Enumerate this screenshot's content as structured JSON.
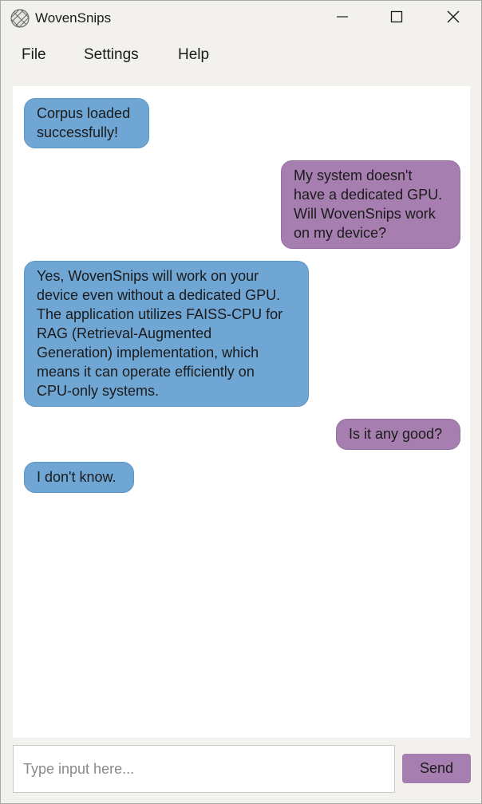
{
  "window": {
    "title": "WovenSnips",
    "logo_icon": "woven-sphere-icon",
    "controls": {
      "minimize_icon": "minimize-icon",
      "maximize_icon": "maximize-icon",
      "close_icon": "close-icon"
    }
  },
  "menu": {
    "items": [
      {
        "label": "File"
      },
      {
        "label": "Settings"
      },
      {
        "label": "Help"
      }
    ]
  },
  "chat": {
    "messages": [
      {
        "sender": "bot",
        "text": "Corpus loaded\nsuccessfully!"
      },
      {
        "sender": "user",
        "text": "My system doesn't\nhave a dedicated GPU.\nWill WovenSnips work\non my device?"
      },
      {
        "sender": "bot",
        "text": "Yes, WovenSnips will work on your\ndevice even without a dedicated GPU.\nThe application utilizes FAISS-CPU for\nRAG (Retrieval-Augmented\nGeneration) implementation, which\nmeans it can operate efficiently on\nCPU-only systems."
      },
      {
        "sender": "user",
        "text": "Is it any good?"
      },
      {
        "sender": "bot",
        "text": "I don't know."
      }
    ]
  },
  "composer": {
    "value": "",
    "placeholder": "Type input here...",
    "send_label": "Send"
  },
  "colors": {
    "bot_bubble": "#6fa6d4",
    "user_bubble": "#a67fb0",
    "window_background": "#f3f1ed",
    "chat_background": "#ffffff"
  }
}
